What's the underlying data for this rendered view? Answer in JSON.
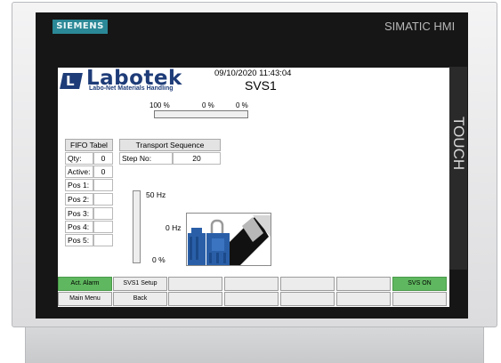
{
  "device": {
    "brand": "SIEMENS",
    "model": "SIMATIC HMI",
    "touch_label": "TOUCH"
  },
  "header": {
    "logo_name": "Labotek",
    "logo_tagline": "Labo-Net Materials Handling",
    "datetime": "09/10/2020 11:43:04",
    "title": "SVS1"
  },
  "progress": {
    "label_1": "100 %",
    "label_2": "0 %",
    "label_3": "0 %",
    "fill_fraction": 0
  },
  "fifo": {
    "title": "FIFO Tabel",
    "qty_label": "Qty:",
    "qty_value": "0",
    "active_label": "Active:",
    "active_value": "0",
    "positions": [
      {
        "label": "Pos 1:",
        "value": ""
      },
      {
        "label": "Pos 2:",
        "value": ""
      },
      {
        "label": "Pos 3:",
        "value": ""
      },
      {
        "label": "Pos 4:",
        "value": ""
      },
      {
        "label": "Pos 5:",
        "value": ""
      }
    ]
  },
  "transport": {
    "title": "Transport Sequence",
    "step_label": "Step No:",
    "step_value": "20"
  },
  "frequency": {
    "max_label": "50 Hz",
    "current_label": "0 Hz",
    "percent_label": "0 %",
    "fill_fraction": 0
  },
  "softkeys": {
    "row1": [
      "Act. Alarm",
      "SVS1 Setup",
      "",
      "",
      "",
      "",
      "SVS ON"
    ],
    "row2": [
      "Main Menu",
      "Back",
      "",
      "",
      "",
      "",
      ""
    ]
  },
  "colors": {
    "brand_teal": "#2b8896",
    "logo_blue": "#1e3c78",
    "status_green": "#5fb85f",
    "machine_blue": "#2a5fa8"
  }
}
